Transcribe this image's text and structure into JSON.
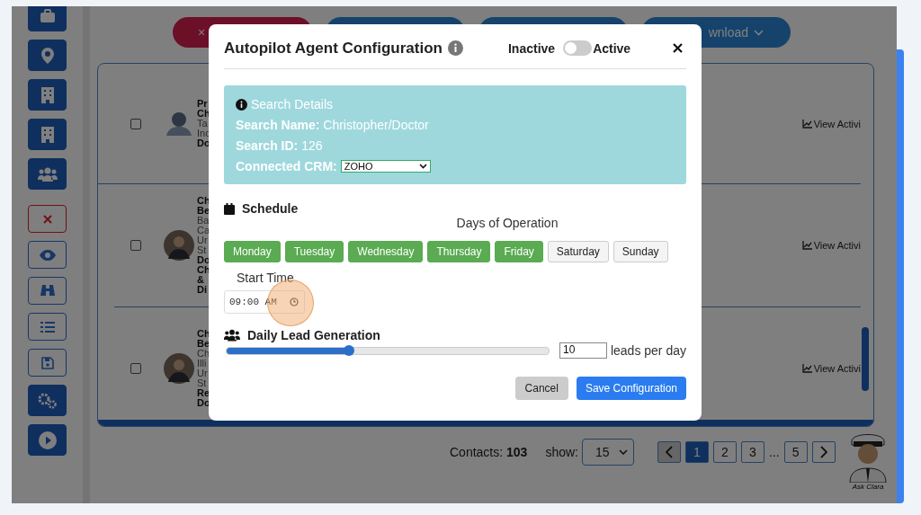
{
  "sidebar": {
    "items": [
      {
        "kind": "filled"
      },
      {
        "kind": "filled"
      },
      {
        "kind": "filled"
      },
      {
        "kind": "filled"
      },
      {
        "kind": "filled"
      },
      {
        "kind": "danger"
      },
      {
        "kind": "outline"
      },
      {
        "kind": "outline"
      },
      {
        "kind": "outline"
      },
      {
        "kind": "outline"
      },
      {
        "kind": "filled"
      },
      {
        "kind": "filled"
      }
    ]
  },
  "toolbar": [
    {
      "kind": "danger",
      "label": "×"
    },
    {
      "kind": "primary"
    },
    {
      "kind": "primary"
    },
    {
      "kind": "primary",
      "label": "wnload"
    }
  ],
  "contacts": [
    {
      "checked": false,
      "kind": "placeholder",
      "lines": [
        {
          "text": "Pr",
          "bold": true
        },
        {
          "text": "Ch",
          "bold": true
        },
        {
          "text": "Ta",
          "bold": false
        },
        {
          "text": "Inc",
          "bold": false
        },
        {
          "text": "Do",
          "bold": true
        }
      ],
      "action": "View Activi"
    },
    {
      "checked": false,
      "kind": "photo",
      "lines": [
        {
          "text": "Ch",
          "bold": true
        },
        {
          "text": "Be",
          "bold": true
        },
        {
          "text": "Ba",
          "bold": false
        },
        {
          "text": "Ca",
          "bold": false
        },
        {
          "text": "Ur",
          "bold": false
        },
        {
          "text": "St",
          "bold": false
        },
        {
          "text": "Do",
          "bold": true
        },
        {
          "text": "Ch",
          "bold": true
        },
        {
          "text": "&",
          "bold": true
        },
        {
          "text": "Di",
          "bold": true
        }
      ],
      "action": "View Activi"
    },
    {
      "checked": false,
      "kind": "photo",
      "lines": [
        {
          "text": "Ch",
          "bold": true
        },
        {
          "text": "Be",
          "bold": true
        },
        {
          "text": "Ch",
          "bold": false
        },
        {
          "text": "Illi",
          "bold": false
        },
        {
          "text": "Ur",
          "bold": false
        },
        {
          "text": "St",
          "bold": false
        },
        {
          "text": "Re",
          "bold": true
        },
        {
          "text": "Do",
          "bold": true
        }
      ],
      "action": "View Activi"
    }
  ],
  "footer": {
    "contacts_label": "Contacts:",
    "contacts_count": "103",
    "show_label": "show:",
    "page_size": "15",
    "pages": [
      {
        "label": "1",
        "selected": true
      },
      {
        "label": "2",
        "selected": false
      },
      {
        "label": "3",
        "selected": false
      },
      {
        "label": "5",
        "selected": false
      }
    ],
    "ellipsis": "..."
  },
  "assistant": {
    "caption": "Ask Clara"
  },
  "modal": {
    "title": "Autopilot Agent Configuration",
    "toggle": {
      "off_label": "Inactive",
      "on_label": "Active",
      "on": false
    },
    "search_details": {
      "heading": "Search Details",
      "fields": [
        {
          "label": "Search Name:",
          "value": "Christopher/Doctor"
        },
        {
          "label": "Search ID:",
          "value": "126"
        }
      ],
      "crm": {
        "label": "Connected CRM:",
        "value": "ZOHO"
      }
    },
    "schedule": {
      "heading": "Schedule",
      "days_label": "Days of Operation",
      "days": [
        {
          "label": "Monday",
          "selected": true
        },
        {
          "label": "Tuesday",
          "selected": true
        },
        {
          "label": "Wednesday",
          "selected": true
        },
        {
          "label": "Thursday",
          "selected": true
        },
        {
          "label": "Friday",
          "selected": true
        },
        {
          "label": "Saturday",
          "selected": false
        },
        {
          "label": "Sunday",
          "selected": false
        }
      ],
      "start_time_label": "Start Time",
      "start_time": "09:00 AM"
    },
    "leads": {
      "heading": "Daily Lead Generation",
      "level": 0.38,
      "value": "10",
      "unit": "leads per day"
    },
    "buttons": [
      {
        "label": "Cancel",
        "kind": "secondary"
      },
      {
        "label": "Save Configuration",
        "kind": "primary"
      }
    ]
  }
}
